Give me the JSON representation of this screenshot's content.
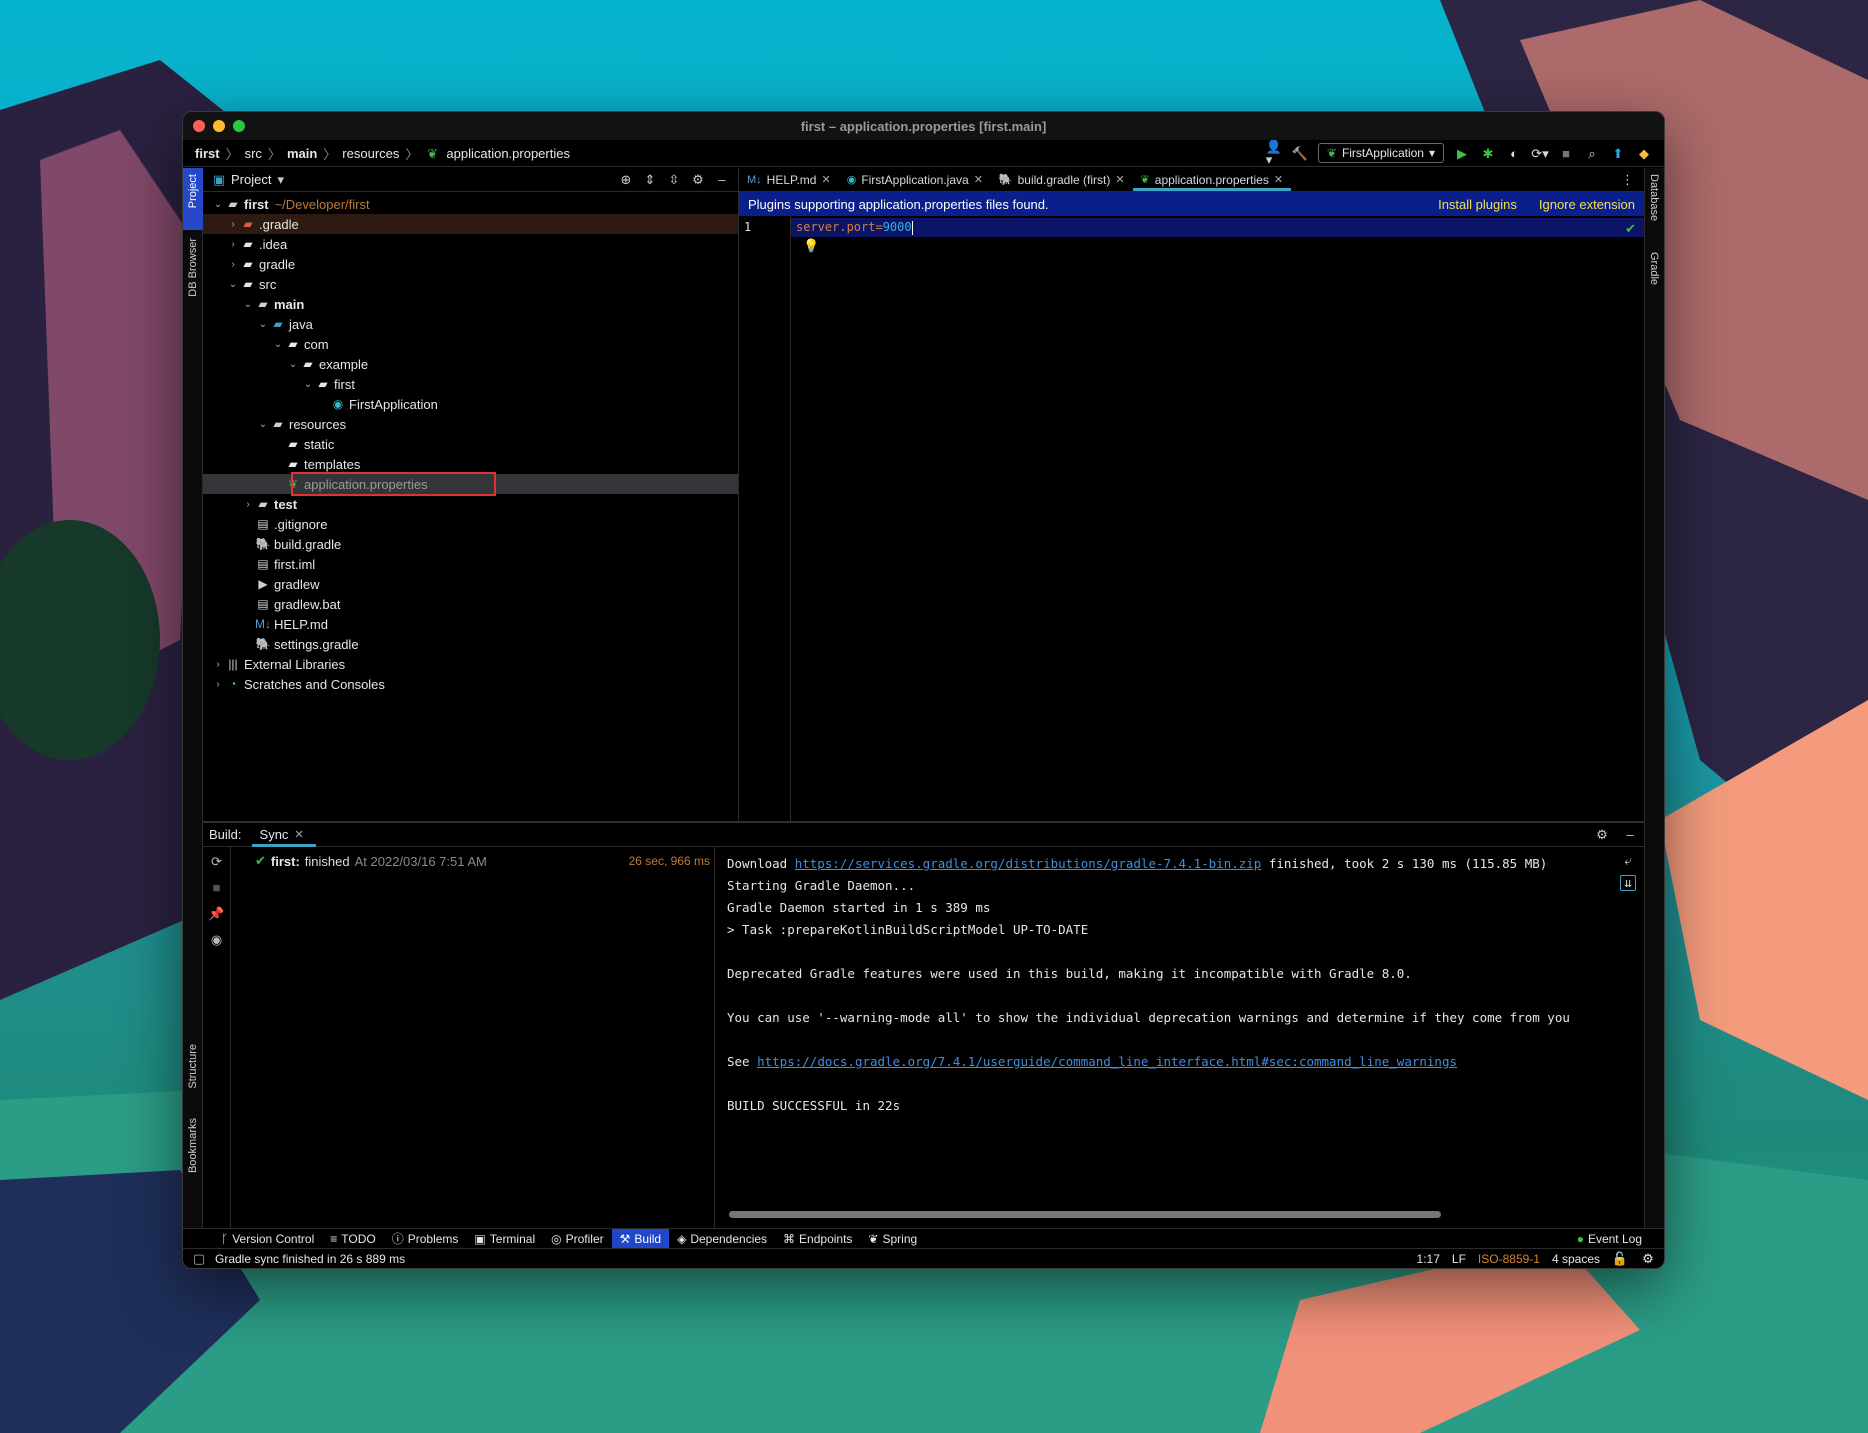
{
  "window": {
    "title": "first – application.properties [first.main]"
  },
  "breadcrumbs": [
    "first",
    "src",
    "main",
    "resources",
    "application.properties"
  ],
  "run_config": "FirstApplication",
  "project_panel": {
    "title": "Project"
  },
  "tree": [
    {
      "label": "first",
      "extra": "~/Developer/first",
      "depth": 0,
      "arrow": "down",
      "icon": "module-folder-icon",
      "bold": true
    },
    {
      "label": ".gradle",
      "depth": 1,
      "arrow": "right",
      "icon": "folder-icon"
    },
    {
      "label": ".idea",
      "depth": 1,
      "arrow": "right",
      "icon": "folder-icon"
    },
    {
      "label": "gradle",
      "depth": 1,
      "arrow": "right",
      "icon": "folder-icon"
    },
    {
      "label": "src",
      "depth": 1,
      "arrow": "down",
      "icon": "folder-icon"
    },
    {
      "label": "main",
      "depth": 2,
      "arrow": "down",
      "icon": "module-folder-icon",
      "bold": true
    },
    {
      "label": "java",
      "depth": 3,
      "arrow": "down",
      "icon": "source-folder-icon"
    },
    {
      "label": "com",
      "depth": 4,
      "arrow": "down",
      "icon": "package-icon"
    },
    {
      "label": "example",
      "depth": 5,
      "arrow": "down",
      "icon": "package-icon"
    },
    {
      "label": "first",
      "depth": 6,
      "arrow": "down",
      "icon": "package-icon"
    },
    {
      "label": "FirstApplication",
      "depth": 7,
      "arrow": "",
      "icon": "spring-class-icon"
    },
    {
      "label": "resources",
      "depth": 3,
      "arrow": "down",
      "icon": "resources-folder-icon"
    },
    {
      "label": "static",
      "depth": 4,
      "arrow": "",
      "icon": "folder-icon"
    },
    {
      "label": "templates",
      "depth": 4,
      "arrow": "",
      "icon": "folder-icon"
    },
    {
      "label": "application.properties",
      "depth": 4,
      "arrow": "",
      "icon": "spring-properties-icon"
    },
    {
      "label": "test",
      "depth": 2,
      "arrow": "right",
      "icon": "module-folder-icon",
      "bold": true
    },
    {
      "label": ".gitignore",
      "depth": 2,
      "arrow": "",
      "icon": "file-icon"
    },
    {
      "label": "build.gradle",
      "depth": 2,
      "arrow": "",
      "icon": "gradle-icon"
    },
    {
      "label": "first.iml",
      "depth": 2,
      "arrow": "",
      "icon": "file-icon"
    },
    {
      "label": "gradlew",
      "depth": 2,
      "arrow": "",
      "icon": "script-icon"
    },
    {
      "label": "gradlew.bat",
      "depth": 2,
      "arrow": "",
      "icon": "file-icon"
    },
    {
      "label": "HELP.md",
      "depth": 2,
      "arrow": "",
      "icon": "markdown-icon"
    },
    {
      "label": "settings.gradle",
      "depth": 2,
      "arrow": "",
      "icon": "gradle-icon"
    },
    {
      "label": "External Libraries",
      "depth": 0,
      "arrow": "right",
      "icon": "libraries-icon"
    },
    {
      "label": "Scratches and Consoles",
      "depth": 0,
      "arrow": "right",
      "icon": "scratches-icon"
    }
  ],
  "editor_tabs": [
    {
      "label": "HELP.md",
      "icon": "markdown-icon",
      "active": false
    },
    {
      "label": "FirstApplication.java",
      "icon": "spring-class-icon",
      "active": false
    },
    {
      "label": "build.gradle (first)",
      "icon": "gradle-icon",
      "active": false
    },
    {
      "label": "application.properties",
      "icon": "spring-properties-icon",
      "active": true
    }
  ],
  "banner": {
    "text": "Plugins supporting application.properties files found.",
    "install": "Install plugins",
    "ignore": "Ignore extension"
  },
  "editor": {
    "line_number": "1",
    "key": "server.port=",
    "value": "9000"
  },
  "left_strip": {
    "project": "Project",
    "db_browser": "DB Browser",
    "structure": "Structure",
    "bookmarks": "Bookmarks"
  },
  "right_strip": {
    "database": "Database",
    "gradle": "Gradle"
  },
  "build": {
    "label": "Build:",
    "tab": "Sync",
    "task_name": "first:",
    "task_status": "finished",
    "task_time": "At 2022/03/16 7:51 AM",
    "duration": "26 sec, 966 ms"
  },
  "console": {
    "l1_pre": "Download ",
    "l1_link": "https://services.gradle.org/distributions/gradle-7.4.1-bin.zip",
    "l1_post": " finished, took 2 s 130 ms (115.85 MB)",
    "l2": "Starting Gradle Daemon...",
    "l3": "Gradle Daemon started in 1 s 389 ms",
    "l4": "> Task :prepareKotlinBuildScriptModel UP-TO-DATE",
    "l5": "Deprecated Gradle features were used in this build, making it incompatible with Gradle 8.0.",
    "l6": "You can use '--warning-mode all' to show the individual deprecation warnings and determine if they come from you",
    "l7_pre": "See ",
    "l7_link": "https://docs.gradle.org/7.4.1/userguide/command_line_interface.html#sec:command_line_warnings",
    "l8": "BUILD SUCCESSFUL in 22s"
  },
  "toolwindows": [
    "Version Control",
    "TODO",
    "Problems",
    "Terminal",
    "Profiler",
    "Build",
    "Dependencies",
    "Endpoints",
    "Spring"
  ],
  "event_log": "Event Log",
  "status": {
    "message": "Gradle sync finished in 26 s 889 ms",
    "position": "1:17",
    "line_sep": "LF",
    "encoding": "ISO-8859-1",
    "indent": "4 spaces"
  }
}
